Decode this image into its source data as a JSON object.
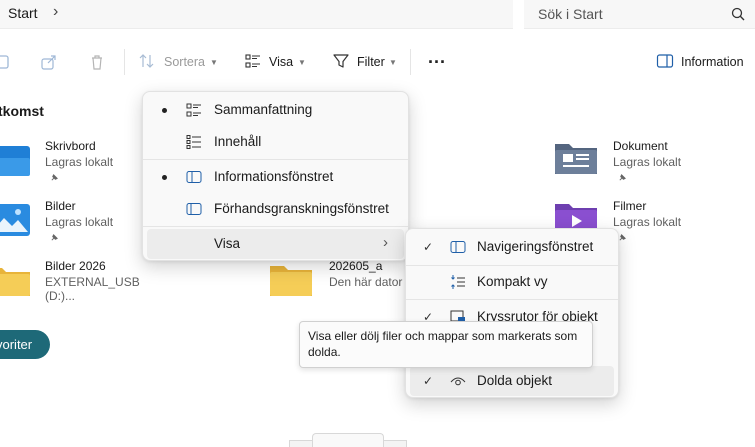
{
  "address": {
    "crumb": "Start"
  },
  "search": {
    "placeholder": "Sök i Start"
  },
  "toolbar": {
    "sort_label": "Sortera",
    "view_label": "Visa",
    "filter_label": "Filter",
    "more_label": "...",
    "details_label": "Information"
  },
  "quick_access": {
    "title": "tkomst",
    "items": [
      {
        "name": "Skrivbord",
        "sub": "Lagras lokalt"
      },
      {
        "name": "Bilder",
        "sub": "Lagras lokalt"
      },
      {
        "name": "Bilder 2026",
        "sub": "EXTERNAL_USB (D:)..."
      },
      {
        "name": "202605_a",
        "sub": "Den här dator"
      },
      {
        "name": "Dokument",
        "sub": "Lagras lokalt"
      },
      {
        "name": "Filmer",
        "sub": "Lagras lokalt"
      }
    ]
  },
  "favorites_button": "voriter",
  "view_menu": {
    "items": [
      {
        "label": "Sammanfattning",
        "selected": true
      },
      {
        "label": "Innehåll",
        "selected": false
      },
      {
        "label": "Informationsfönstret",
        "selected": true
      },
      {
        "label": "Förhandsgranskningsfönstret",
        "selected": false
      },
      {
        "label": "Visa",
        "selected": false
      }
    ]
  },
  "show_submenu": {
    "items": [
      {
        "label": "Navigeringsfönstret",
        "checked": true
      },
      {
        "label": "Kompakt vy",
        "checked": false
      },
      {
        "label": "Kryssrutor för objekt",
        "checked": true
      },
      {
        "label": "Dolda objekt",
        "checked": true
      }
    ]
  },
  "tooltip": {
    "text": "Visa eller dölj filer och mappar som markerats som dolda."
  },
  "colors": {
    "accent": "#1e6978",
    "folder": "#f3c64b",
    "blue_icon": "#2a7fd4"
  }
}
